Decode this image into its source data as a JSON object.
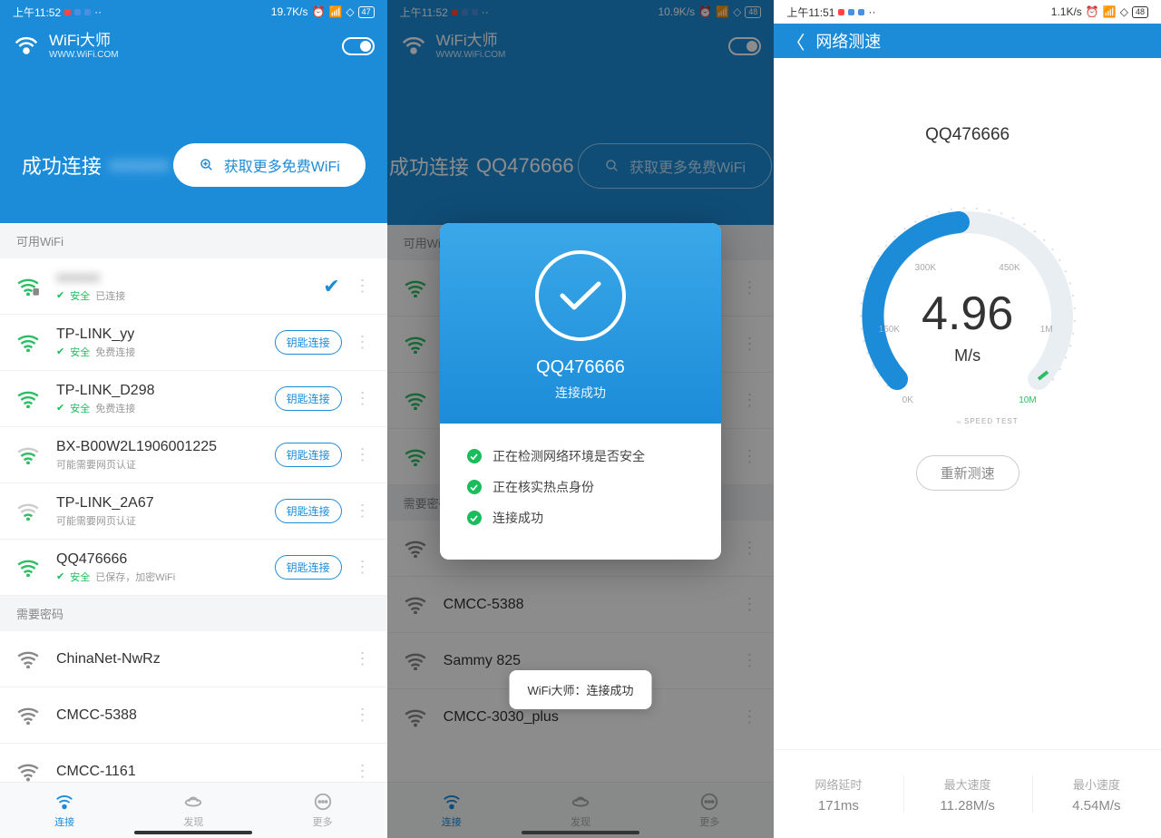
{
  "panels": {
    "p1": {
      "status": {
        "time": "上午11:52",
        "speed": "19.7K/s",
        "battery": "47"
      },
      "brand": {
        "title": "WiFi大师",
        "sub": "WWW.WiFi.COM"
      },
      "hero": {
        "prefix": "成功连接",
        "ssid": "●●●●●"
      },
      "get_more": "获取更多免费WiFi",
      "section_available": "可用WiFi",
      "section_pwd": "需要密码",
      "wifi": [
        {
          "ssid": "●●●●●",
          "secure": "安全",
          "extra": "已连接",
          "connected": true,
          "blurred": true
        },
        {
          "ssid": "TP-LINK_yy",
          "secure": "安全",
          "extra": "免费连接",
          "key": true
        },
        {
          "ssid": "TP-LINK_D298",
          "secure": "安全",
          "extra": "免费连接",
          "key": true
        },
        {
          "ssid": "BX-B00W2L1906001225",
          "note": "可能需要网页认证",
          "key": true
        },
        {
          "ssid": "TP-LINK_2A67",
          "note": "可能需要网页认证",
          "key": true
        },
        {
          "ssid": "QQ476666",
          "secure": "安全",
          "extra": "已保存，加密WiFi",
          "key": true
        }
      ],
      "pwd_list": [
        {
          "ssid": "ChinaNet-NwRz"
        },
        {
          "ssid": "CMCC-5388"
        },
        {
          "ssid": "CMCC-1161"
        }
      ],
      "key_label": "钥匙连接",
      "tabs": {
        "connect": "连接",
        "discover": "发现",
        "more": "更多"
      }
    },
    "p2": {
      "status": {
        "time": "上午11:52",
        "speed": "10.9K/s",
        "battery": "48"
      },
      "hero": {
        "prefix": "成功连接",
        "ssid": "QQ476666"
      },
      "get_more": "获取更多免费WiFi",
      "section_available": "可用WiFi",
      "dialog": {
        "ssid": "QQ476666",
        "status": "连接成功",
        "steps": [
          "正在检测网络环境是否安全",
          "正在核实热点身份",
          "连接成功"
        ]
      },
      "toast": "WiFi大师：连接成功",
      "bg_pwd": [
        "CMCC-5388",
        "Sammy 825",
        "CMCC-3030_plus"
      ],
      "tabs": {
        "connect": "连接",
        "discover": "发现",
        "more": "更多"
      }
    },
    "p3": {
      "status": {
        "time": "上午11:51",
        "speed": "1.1K/s",
        "battery": "48"
      },
      "title": "网络测速",
      "ssid": "QQ476666",
      "gauge": {
        "value": "4.96",
        "unit": "M/s",
        "ticks": {
          "k0": "0K",
          "k150": "150K",
          "k300": "300K",
          "k450": "450K",
          "m1": "1M",
          "m10": "10M"
        },
        "footer": "SPEED TEST"
      },
      "retest": "重新测速",
      "metrics": [
        {
          "label": "网络延时",
          "value": "171ms"
        },
        {
          "label": "最大速度",
          "value": "11.28M/s"
        },
        {
          "label": "最小速度",
          "value": "4.54M/s"
        }
      ]
    }
  }
}
